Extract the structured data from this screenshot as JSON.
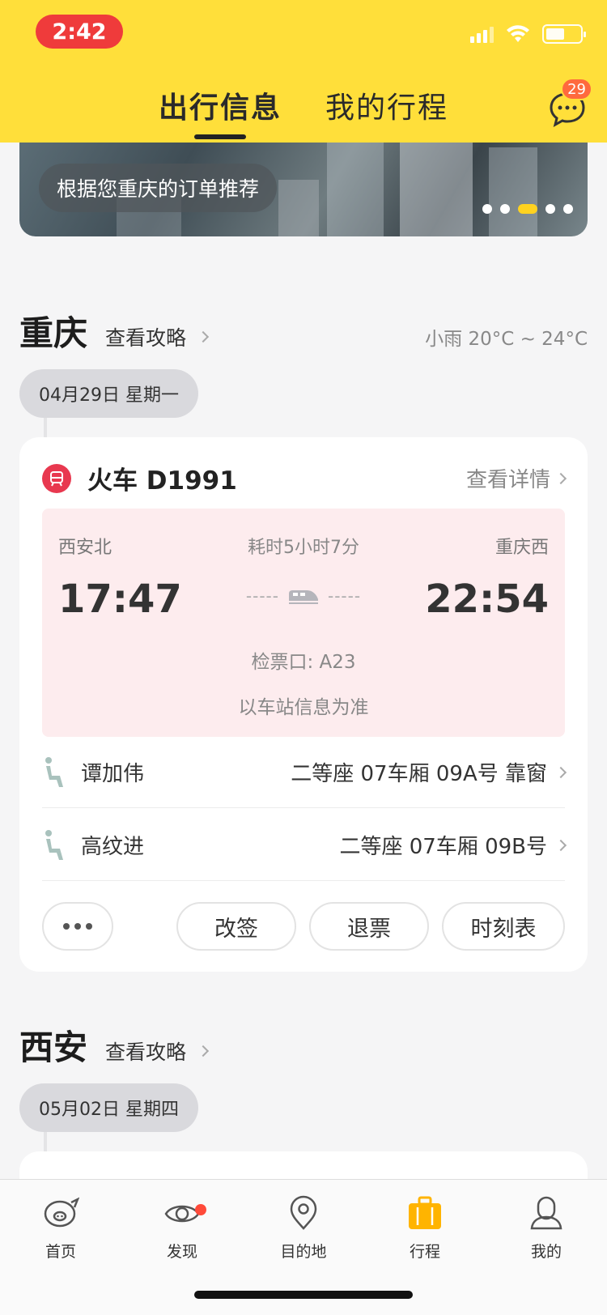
{
  "status": {
    "time": "2:42"
  },
  "header": {
    "tabs": [
      {
        "label": "出行信息"
      },
      {
        "label": "我的行程"
      }
    ],
    "messages_badge": "29"
  },
  "banner": {
    "label": "根据您重庆的订单推荐"
  },
  "sections": [
    {
      "city": "重庆",
      "guide": "查看攻略",
      "weather": "小雨 20°C ~ 24°C",
      "date": "04月29日 星期一",
      "trip": {
        "title": "火车 D1991",
        "detail_link": "查看详情",
        "from_station": "西安北",
        "to_station": "重庆西",
        "duration": "耗时5小时7分",
        "dep_time": "17:47",
        "arr_time": "22:54",
        "gate": "检票口: A23",
        "note": "以车站信息为准",
        "passengers": [
          {
            "name": "谭加伟",
            "seat": "二等座 07车厢 09A号 靠窗"
          },
          {
            "name": "高纹进",
            "seat": "二等座 07车厢 09B号"
          }
        ],
        "actions": {
          "change": "改签",
          "refund": "退票",
          "timetable": "时刻表"
        }
      }
    },
    {
      "city": "西安",
      "guide": "查看攻略",
      "date": "05月02日 星期四"
    }
  ],
  "tabbar": [
    {
      "label": "首页",
      "icon": "pig-home-icon"
    },
    {
      "label": "发现",
      "icon": "eye-discover-icon"
    },
    {
      "label": "目的地",
      "icon": "location-pin-icon"
    },
    {
      "label": "行程",
      "icon": "suitcase-icon",
      "active": true
    },
    {
      "label": "我的",
      "icon": "profile-icon"
    }
  ],
  "colors": {
    "brand_yellow": "#ffdf3a",
    "train_red": "#e8384f",
    "route_bg": "#fdecee",
    "active_tab": "#ffb400"
  }
}
